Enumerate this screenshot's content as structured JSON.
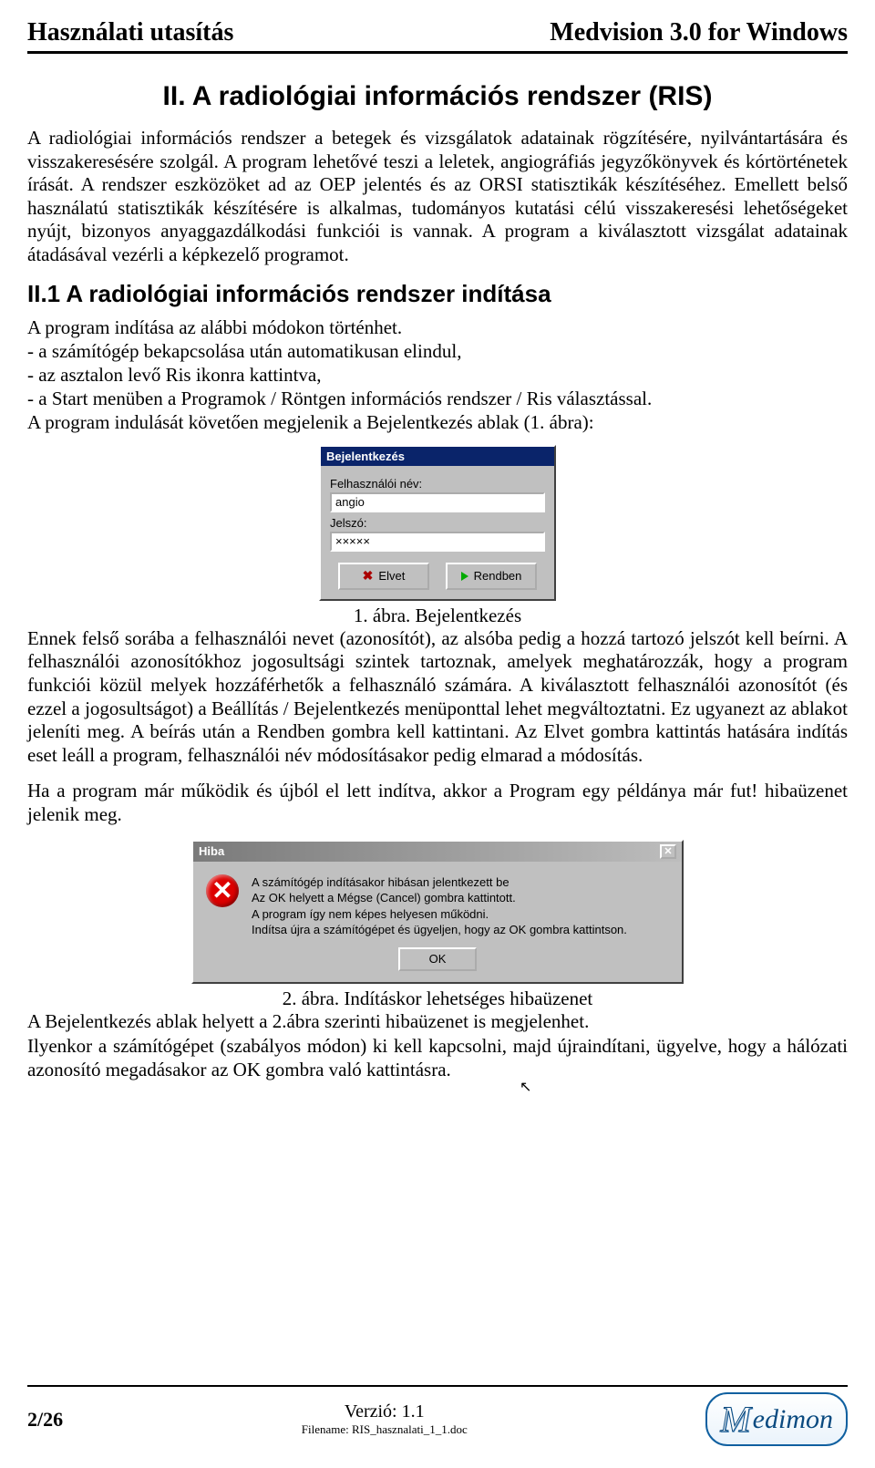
{
  "header": {
    "left": "Használati utasítás",
    "right": "Medvision 3.0 for Windows"
  },
  "chapter_title": "II. A radiológiai információs rendszer (RIS)",
  "para1": "A radiológiai információs rendszer a betegek és vizsgálatok adatainak rögzítésére, nyilvántartására és visszakeresésére szolgál. A program lehetővé teszi a leletek, angiográfiás jegyzőkönyvek és kórtörténetek írását. A rendszer eszközöket ad az OEP jelentés és az ORSI statisztikák készítéséhez. Emellett belső használatú statisztikák készítésére is alkalmas, tudományos kutatási célú visszakeresési lehetőségeket nyújt, bizonyos anyaggazdálkodási funkciói is vannak. A program a kiválasztott vizsgálat adatainak átadásával vezérli a képkezelő programot.",
  "section_title": "II.1 A radiológiai információs rendszer indítása",
  "intro_line": "A program indítása az alábbi módokon történhet.",
  "bullets": [
    "- a számítógép bekapcsolása után automatikusan elindul,",
    "- az asztalon levő Ris ikonra kattintva,",
    "- a Start menüben a Programok / Röntgen információs rendszer / Ris választással."
  ],
  "after_bullets": "A program indulását követően megjelenik a Bejelentkezés ablak (1. ábra):",
  "login": {
    "title": "Bejelentkezés",
    "label_user": "Felhasználói név:",
    "value_user": "angio",
    "label_pass": "Jelszó:",
    "value_pass": "×××××",
    "btn_cancel": "Elvet",
    "btn_ok": "Rendben"
  },
  "fig1_caption": "1. ábra. Bejelentkezés",
  "para2": "Ennek felső sorába a felhasználói nevet (azonosítót), az alsóba pedig a hozzá tartozó jelszót kell beírni. A felhasználói azonosítókhoz jogosultsági szintek tartoznak, amelyek meghatározzák, hogy a program funkciói közül melyek hozzáférhetők a felhasználó számára. A kiválasztott felhasználói azonosítót (és ezzel a jogosultságot) a Beállítás / Bejelentkezés menüponttal lehet megváltoztatni. Ez ugyanezt az ablakot jeleníti meg. A beírás után a Rendben gombra kell kattintani. Az Elvet gombra kattintás hatására indítás eset leáll a program, felhasználói név módosításakor pedig elmarad a módosítás.",
  "para3": "Ha a program már működik és újból el lett indítva, akkor a Program egy példánya már fut! hibaüzenet jelenik meg.",
  "error": {
    "title": "Hiba",
    "lines": [
      "A számítógép indításakor hibásan jelentkezett be",
      "Az OK helyett a Mégse (Cancel) gombra kattintott.",
      "A program így nem képes helyesen működni.",
      "Indítsa újra a számítógépet és ügyeljen, hogy az OK gombra kattintson."
    ],
    "btn_ok": "OK"
  },
  "fig2_caption": "2. ábra. Indításkor lehetséges hibaüzenet",
  "para4": "A Bejelentkezés ablak helyett a 2.ábra szerinti hibaüzenet is megjelenhet.",
  "para5": "Ilyenkor a számítógépet (szabályos módon) ki kell kapcsolni, majd újraindítani, ügyelve, hogy a hálózati azonosító megadásakor az OK gombra való kattintásra.",
  "footer": {
    "page": "2/26",
    "version": "Verzió: 1.1",
    "filename": "Filename: RIS_hasznalati_1_1.doc",
    "logo_text": "edimon"
  }
}
